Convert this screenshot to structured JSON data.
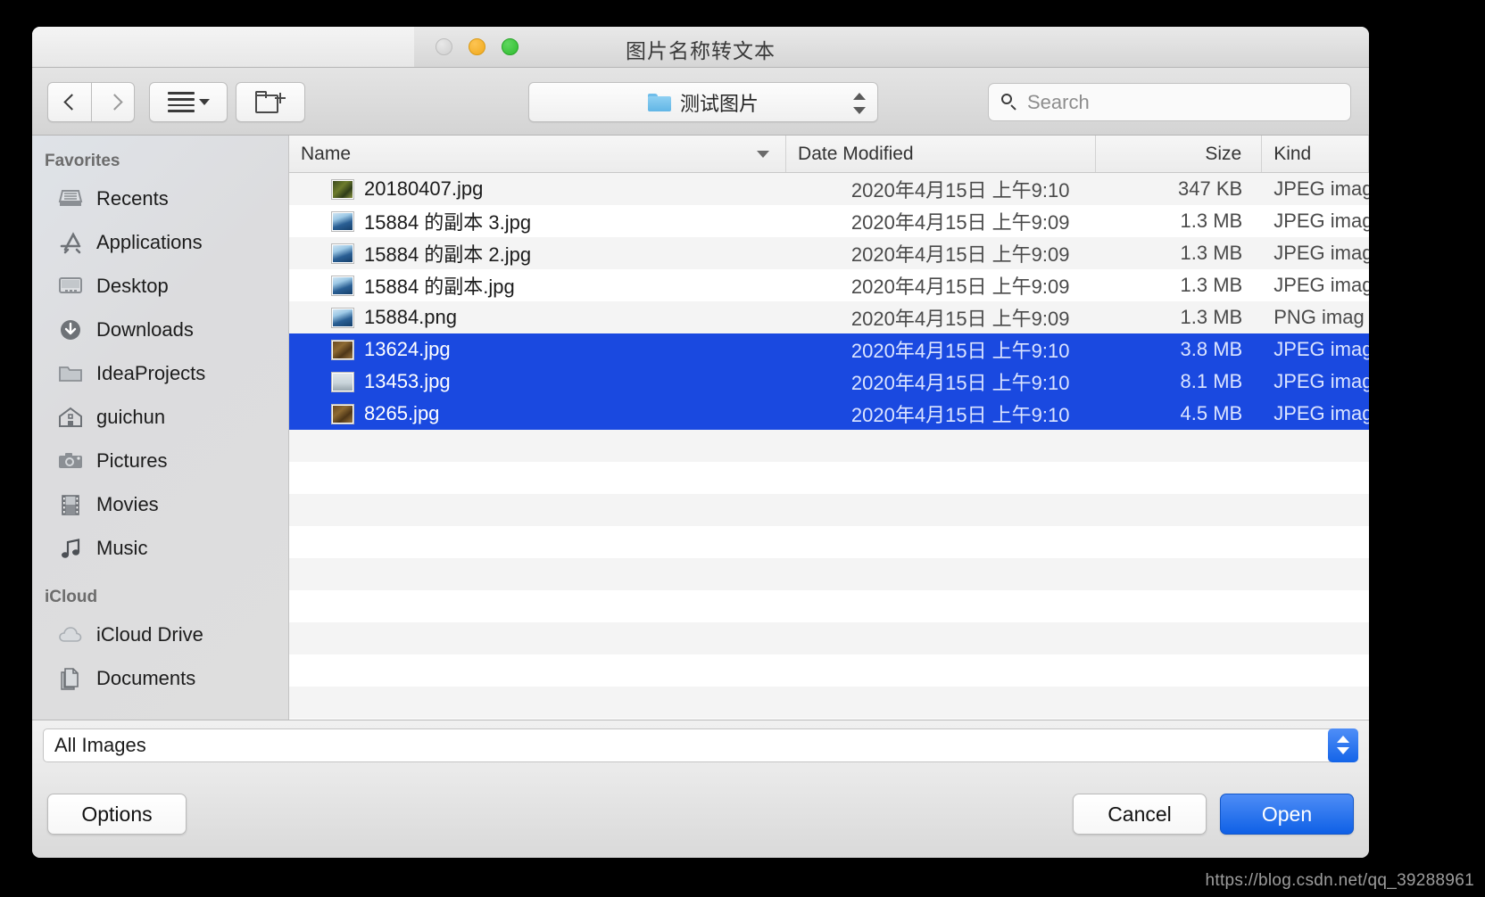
{
  "window": {
    "title": "图片名称转文本",
    "traffic_lights": [
      "close",
      "minimize",
      "maximize"
    ]
  },
  "toolbar": {
    "back_label": "",
    "forward_label": "",
    "view_label": "",
    "new_folder_label": "",
    "path_label": "测试图片",
    "search_placeholder": "Search",
    "search_value": ""
  },
  "sidebar": {
    "sections": [
      {
        "title": "Favorites",
        "items": [
          {
            "label": "Recents",
            "icon": "recents-icon"
          },
          {
            "label": "Applications",
            "icon": "applications-icon"
          },
          {
            "label": "Desktop",
            "icon": "desktop-icon"
          },
          {
            "label": "Downloads",
            "icon": "downloads-icon"
          },
          {
            "label": "IdeaProjects",
            "icon": "folder-icon"
          },
          {
            "label": "guichun",
            "icon": "home-icon"
          },
          {
            "label": "Pictures",
            "icon": "camera-icon"
          },
          {
            "label": "Movies",
            "icon": "film-icon"
          },
          {
            "label": "Music",
            "icon": "music-note-icon"
          }
        ]
      },
      {
        "title": "iCloud",
        "items": [
          {
            "label": "iCloud Drive",
            "icon": "cloud-icon"
          },
          {
            "label": "Documents",
            "icon": "documents-icon"
          }
        ]
      }
    ]
  },
  "file_list": {
    "columns": [
      "Name",
      "Date Modified",
      "Size",
      "Kind"
    ],
    "sort_column": "Name",
    "sort_direction": "descending",
    "rows": [
      {
        "name": "20180407.jpg",
        "date": "2020年4月15日 上午9:10",
        "size": "347 KB",
        "kind": "JPEG imag",
        "selected": false,
        "thumb": "th-green"
      },
      {
        "name": "15884 的副本 3.jpg",
        "date": "2020年4月15日 上午9:09",
        "size": "1.3 MB",
        "kind": "JPEG imag",
        "selected": false,
        "thumb": "th-blue"
      },
      {
        "name": "15884 的副本 2.jpg",
        "date": "2020年4月15日 上午9:09",
        "size": "1.3 MB",
        "kind": "JPEG imag",
        "selected": false,
        "thumb": "th-blue"
      },
      {
        "name": "15884 的副本.jpg",
        "date": "2020年4月15日 上午9:09",
        "size": "1.3 MB",
        "kind": "JPEG imag",
        "selected": false,
        "thumb": "th-blue"
      },
      {
        "name": "15884.png",
        "date": "2020年4月15日 上午9:09",
        "size": "1.3 MB",
        "kind": "PNG imag",
        "selected": false,
        "thumb": "th-blue"
      },
      {
        "name": "13624.jpg",
        "date": "2020年4月15日 上午9:10",
        "size": "3.8 MB",
        "kind": "JPEG imag",
        "selected": true,
        "thumb": "th-brown"
      },
      {
        "name": "13453.jpg",
        "date": "2020年4月15日 上午9:10",
        "size": "8.1 MB",
        "kind": "JPEG imag",
        "selected": true,
        "thumb": "th-grey"
      },
      {
        "name": "8265.jpg",
        "date": "2020年4月15日 上午9:10",
        "size": "4.5 MB",
        "kind": "JPEG imag",
        "selected": true,
        "thumb": "th-brown"
      }
    ],
    "empty_rows": 12
  },
  "filter": {
    "value": "All Images"
  },
  "buttons": {
    "options": "Options",
    "cancel": "Cancel",
    "open": "Open"
  },
  "watermark": "https://blog.csdn.net/qq_39288961",
  "colors": {
    "selection_blue": "#1a49e0",
    "default_button_blue": "#0f60e6",
    "folder_blue": "#61b6e6"
  }
}
